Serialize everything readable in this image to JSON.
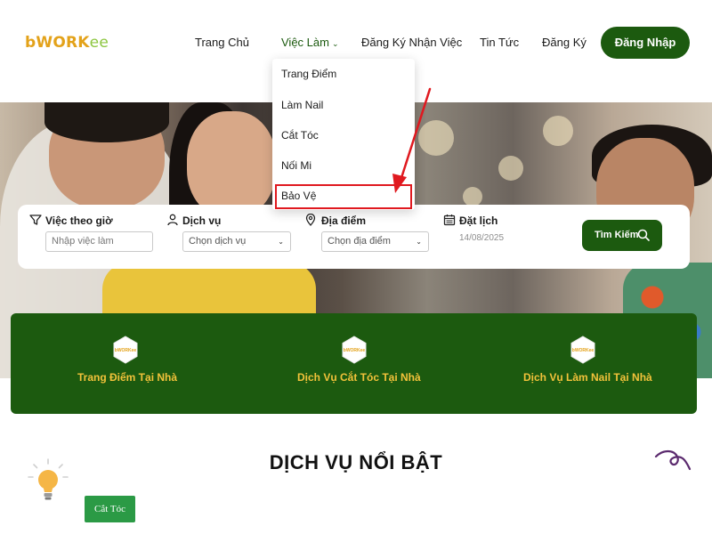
{
  "brand": {
    "logo_b": "b",
    "logo_work": "WORK",
    "logo_ee": "ee"
  },
  "nav": {
    "items": [
      "Trang Chủ",
      "Việc Làm",
      "Đăng Ký Nhận Việc",
      "Tin Tức",
      "Đăng Ký"
    ],
    "active_index": 1,
    "login": "Đăng Nhập"
  },
  "dropdown": {
    "items": [
      "Trang Điểm",
      "Làm Nail",
      "Cắt Tóc",
      "Nối Mi",
      "Bảo Vệ"
    ],
    "highlighted": "Bảo Vệ"
  },
  "search": {
    "fields": [
      {
        "label": "Việc theo giờ",
        "icon": "filter-icon",
        "placeholder": "Nhập việc làm"
      },
      {
        "label": "Dịch vụ",
        "icon": "user-icon",
        "value": "Chọn dịch vụ"
      },
      {
        "label": "Địa điểm",
        "icon": "map-pin-icon",
        "value": "Chọn địa điểm"
      },
      {
        "label": "Đặt lịch",
        "icon": "calendar-icon",
        "value": "14/08/2025"
      }
    ],
    "button": "Tìm Kiếm"
  },
  "services": [
    {
      "label": "Trang Điểm Tại Nhà",
      "icon": "bworkee-hex-icon"
    },
    {
      "label": "Dịch Vụ Cắt Tóc Tại Nhà",
      "icon": "bworkee-hex-icon"
    },
    {
      "label": "Dịch Vụ Làm Nail Tại Nhà",
      "icon": "bworkee-hex-icon"
    }
  ],
  "hex_badge_text": "bWORKee",
  "featured": {
    "title": "DỊCH VỤ NỔI BẬT",
    "tag": "Cắt Tóc"
  },
  "colors": {
    "primary": "#1c5a0f",
    "accent": "#f2c23a",
    "highlight": "#e0191f",
    "tag": "#2b9a45"
  }
}
